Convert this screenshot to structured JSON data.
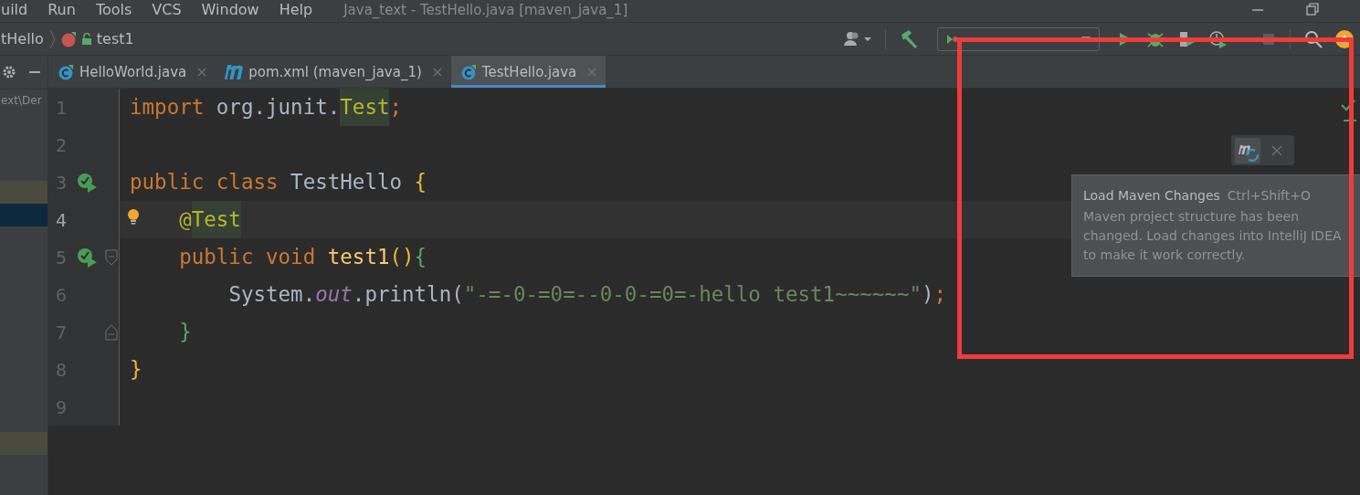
{
  "menu_bar": {
    "items": [
      {
        "label": "uild"
      },
      {
        "label": "Run"
      },
      {
        "label": "Tools"
      },
      {
        "label": "VCS"
      },
      {
        "label": "Window"
      },
      {
        "label": "Help"
      }
    ],
    "title": "Java_text - TestHello.java [maven_java_1]"
  },
  "breadcrumbs": [
    {
      "label": "tHello",
      "kind": "class"
    },
    {
      "label": "test1",
      "kind": "method"
    }
  ],
  "tool_window": {
    "rows": [
      {
        "text": "ext\\Der",
        "kind": "plain"
      },
      {
        "kind": "plain"
      },
      {
        "kind": "plain"
      },
      {
        "kind": "plain"
      },
      {
        "kind": "match"
      },
      {
        "kind": "selected"
      },
      {
        "kind": "plain"
      },
      {
        "kind": "plain"
      },
      {
        "kind": "plain"
      },
      {
        "kind": "plain"
      },
      {
        "kind": "plain"
      },
      {
        "kind": "plain"
      },
      {
        "kind": "plain"
      },
      {
        "kind": "plain"
      },
      {
        "kind": "plain"
      },
      {
        "kind": "match"
      }
    ]
  },
  "tabs": [
    {
      "label": "HelloWorld.java",
      "kind": "java",
      "selected": false
    },
    {
      "label": "pom.xml (maven_java_1)",
      "kind": "maven",
      "selected": false
    },
    {
      "label": "TestHello.java",
      "kind": "java",
      "selected": true
    }
  ],
  "editor": {
    "lines": [
      {
        "number": "1",
        "current": false,
        "tokens": [
          {
            "text": "import ",
            "kind": "keyword"
          },
          {
            "text": "org.junit.",
            "kind": "plain"
          },
          {
            "text": "Test",
            "kind": "annotation",
            "highlighted": true
          },
          {
            "text": ";",
            "kind": "keyword"
          }
        ]
      },
      {
        "number": "2",
        "current": false
      },
      {
        "number": "3",
        "current": false,
        "gutter_icon": {
          "kind": "run"
        },
        "tokens": [
          {
            "text": "public class ",
            "kind": "keyword"
          },
          {
            "text": "TestHello ",
            "kind": "plain"
          },
          {
            "text": "{",
            "kind": "brace"
          }
        ]
      },
      {
        "number": "4",
        "current": true,
        "gutter_icon": {
          "kind": "bulb"
        },
        "tokens": [
          {
            "text": "    @",
            "kind": "annotation"
          },
          {
            "text": "Test",
            "kind": "annotation",
            "highlighted": true
          }
        ]
      },
      {
        "number": "5",
        "current": false,
        "gutter_icon": {
          "kind": "run"
        },
        "fold_marker": {
          "kind": "start"
        },
        "tokens": [
          {
            "text": "    public void ",
            "kind": "keyword"
          },
          {
            "text": "test1",
            "kind": "method"
          },
          {
            "text": "()",
            "kind": "brace"
          },
          {
            "text": "{",
            "kind": "inner-brace"
          }
        ]
      },
      {
        "number": "6",
        "current": false,
        "tokens": [
          {
            "text": "        System.",
            "kind": "plain"
          },
          {
            "text": "out",
            "kind": "field"
          },
          {
            "text": ".println(",
            "kind": "plain"
          },
          {
            "text": "\"-=-0-=0=--0-0-=0=-hello test1~~~~~~\"",
            "kind": "string"
          },
          {
            "text": ")",
            "kind": "plain"
          },
          {
            "text": ";",
            "kind": "keyword"
          }
        ]
      },
      {
        "number": "7",
        "current": false,
        "fold_marker": {
          "kind": "end"
        },
        "tokens": [
          {
            "text": "    }",
            "kind": "inner-brace"
          }
        ]
      },
      {
        "number": "8",
        "current": false,
        "tokens": [
          {
            "text": "}",
            "kind": "brace"
          }
        ]
      },
      {
        "number": "9",
        "current": false
      }
    ]
  },
  "maven_popup": {
    "title": "Load Maven Changes",
    "shortcut": "Ctrl+Shift+O",
    "message": "Maven project structure has been changed. Load changes into IntelliJ IDEA to make it work correctly."
  },
  "annotation_frame": {
    "kind": "rectangle"
  }
}
